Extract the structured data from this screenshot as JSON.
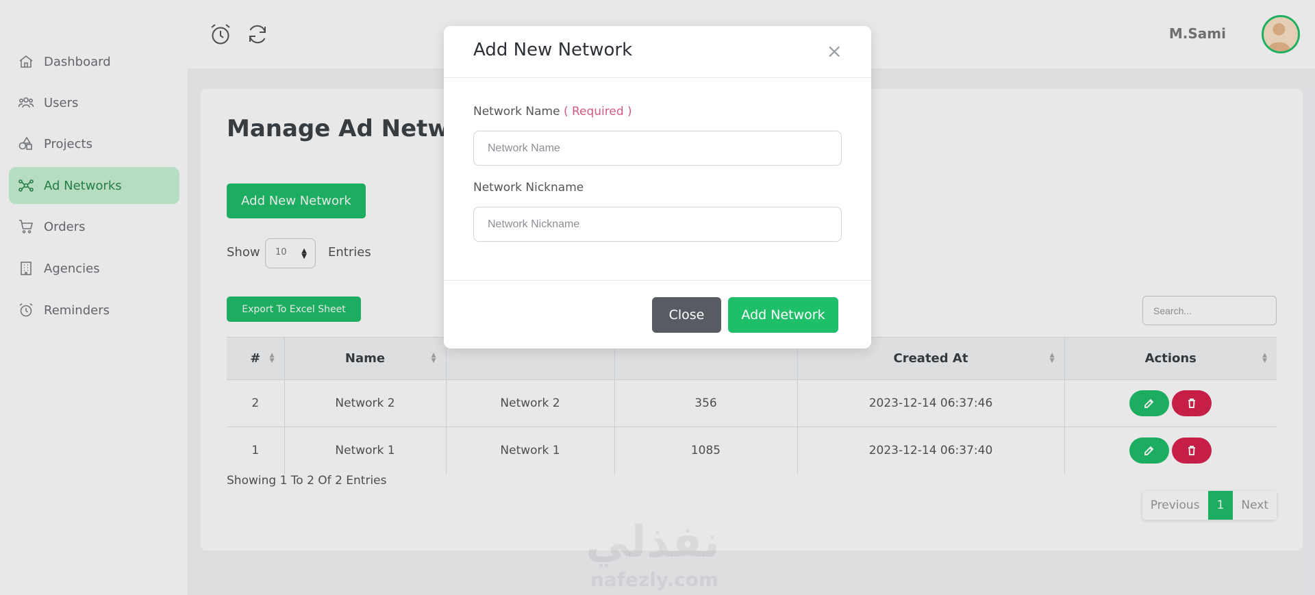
{
  "sidebar": {
    "items": [
      {
        "label": "Dashboard",
        "icon": "home-icon"
      },
      {
        "label": "Users",
        "icon": "users-icon"
      },
      {
        "label": "Projects",
        "icon": "shapes-icon"
      },
      {
        "label": "Ad Networks",
        "icon": "network-icon",
        "active": true
      },
      {
        "label": "Orders",
        "icon": "cart-icon"
      },
      {
        "label": "Agencies",
        "icon": "building-icon"
      },
      {
        "label": "Reminders",
        "icon": "alarm-icon"
      }
    ]
  },
  "header": {
    "icons": [
      "alarm-icon",
      "refresh-icon"
    ],
    "user_name": "M.Sami"
  },
  "main": {
    "title": "Manage Ad Network",
    "add_button": "Add New Network",
    "show_label": "Show",
    "entries_select": "10",
    "entries_label": "Entries",
    "export_button": "Export To Excel Sheet",
    "search_placeholder": "Search...",
    "table": {
      "columns": [
        "#",
        "Name",
        "",
        "",
        "Created At",
        "Actions"
      ],
      "rows": [
        {
          "id": "2",
          "name": "Network 2",
          "nickname": "Network 2",
          "count": "356",
          "created_at": "2023-12-14 06:37:46"
        },
        {
          "id": "1",
          "name": "Network 1",
          "nickname": "Network 1",
          "count": "1085",
          "created_at": "2023-12-14 06:37:40"
        }
      ]
    },
    "showing": "Showing 1 To 2 Of 2 Entries",
    "pagination": {
      "previous": "Previous",
      "current": "1",
      "next": "Next"
    }
  },
  "watermark": {
    "text": "نفذلي",
    "sub": "nafezly.com"
  },
  "modal": {
    "title": "Add New Network",
    "close_x": "×",
    "field1_label": "Network Name",
    "field1_required": "( Required )",
    "field1_placeholder": "Network Name",
    "field2_label": "Network Nickname",
    "field2_placeholder": "Network Nickname",
    "close_button": "Close",
    "submit_button": "Add Network"
  },
  "colors": {
    "accent": "#1fbf6a",
    "danger": "#d9234f",
    "active_nav_bg": "#c9f2d5"
  }
}
